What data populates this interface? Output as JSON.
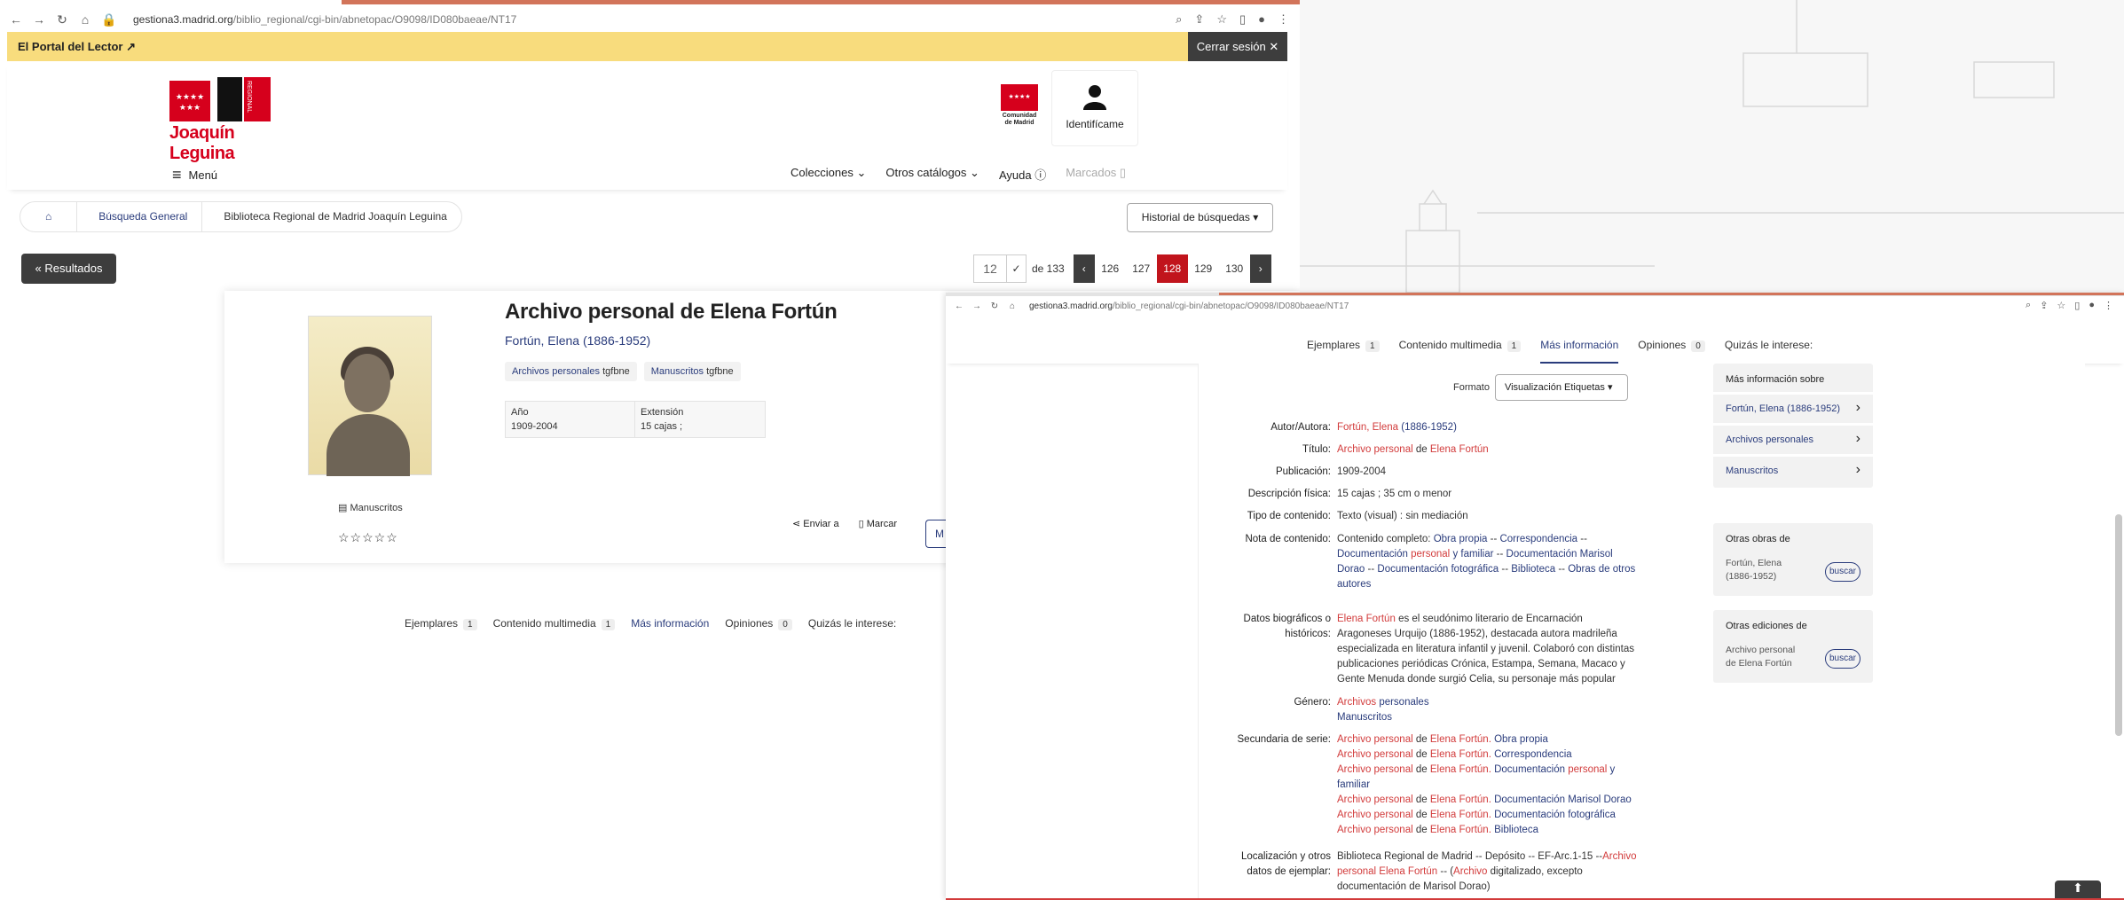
{
  "left_browser": {
    "url_host": "gestiona3.madrid.org",
    "url_path": "/biblio_regional/cgi-bin/abnetopac/O9098/ID080baeae/NT17"
  },
  "portal_bar": {
    "portal_label": "El Portal del Lector",
    "logout_label": "Cerrar sesión"
  },
  "header": {
    "logo_text": "Joaquín Leguina",
    "logo_flag": "★★★★ ★★★",
    "logo_regional": "REGIONAL",
    "cm_line1": "Comunidad",
    "cm_line2": "de Madrid",
    "identify_label": "Identifícame",
    "menu_label": "Menú",
    "nav": {
      "colecciones": "Colecciones",
      "otros": "Otros catálogos",
      "ayuda": "Ayuda",
      "marcados": "Marcados"
    }
  },
  "breadcrumb": {
    "general": "Búsqueda General",
    "library": "Biblioteca Regional de Madrid Joaquín Leguina"
  },
  "historial_label": "Historial de búsquedas",
  "resultados_label": "Resultados",
  "pager": {
    "input_value": "12",
    "total": "de 133",
    "pages": [
      "126",
      "127",
      "128",
      "129",
      "130"
    ],
    "current": "128"
  },
  "record": {
    "title": "Archivo personal de Elena Fortún",
    "author": "Fortún, Elena (1886-1952)",
    "tags": [
      {
        "link": "Archivos personales",
        "suffix": "tgfbne"
      },
      {
        "link": "Manuscritos",
        "suffix": "tgfbne"
      }
    ],
    "year_label": "Año",
    "year_value": "1909-2004",
    "extent_label": "Extensión",
    "extent_value": "15 cajas ;",
    "material": "Manuscritos",
    "stars": "☆☆☆☆☆",
    "send_label": "Enviar a",
    "mark_label": "Marcar",
    "more_btn": "M"
  },
  "tabs": [
    {
      "label": "Ejemplares",
      "badge": "1"
    },
    {
      "label": "Contenido multimedia",
      "badge": "1"
    },
    {
      "label": "Más información",
      "badge": ""
    },
    {
      "label": "Opiniones",
      "badge": "0"
    },
    {
      "label": "Quizás le interese:",
      "badge": ""
    }
  ],
  "details": {
    "formato_label": "Formato",
    "formato_value": "Visualización Etiquetas",
    "fields": {
      "autor": {
        "label": "Autor/Autora:",
        "red": "Fortún, Elena",
        "blue": "(1886-1952)"
      },
      "titulo": {
        "label": "Título:",
        "red1": "Archivo personal",
        "mid": "de",
        "red2": "Elena Fortún"
      },
      "publicacion": {
        "label": "Publicación:",
        "value": "1909-2004"
      },
      "descripcion": {
        "label": "Descripción física:",
        "value": "15 cajas ; 35 cm o menor"
      },
      "tipo": {
        "label": "Tipo de contenido:",
        "value": "Texto (visual) : sin mediación"
      },
      "nota": {
        "label": "Nota de contenido:",
        "prefix": "Contenido completo:",
        "p1": "Obra propia",
        "p2": "Correspondencia",
        "p3a": "Documentación",
        "p3b": "personal",
        "p3c": "y familiar",
        "p4": "Documentación Marisol Dorao",
        "p5": "Documentación fotográfica",
        "p6": "Biblioteca",
        "p7": "Obras de otros autores"
      },
      "bio": {
        "label1": "Datos biográficos o",
        "label2": "históricos:",
        "red": "Elena Fortún",
        "text": "es el seudónimo literario de Encarnación Aragoneses Urquijo (1886-1952), destacada autora madrileña especializada en literatura infantil y juvenil. Colaboró con distintas publicaciones periódicas Crónica, Estampa, Semana, Macaco y Gente Menuda donde surgió Celia, su personaje más popular"
      },
      "genero": {
        "label": "Género:",
        "g1a": "Archivos",
        "g1b": "personales",
        "g2": "Manuscritos"
      },
      "serie": {
        "label": "Secundaria de serie:",
        "red1": "Archivo personal",
        "de": "de",
        "red2": "Elena Fortún.",
        "items": [
          "Obra propia",
          "Correspondencia",
          "Documentación",
          "personal",
          "y familiar",
          "Documentación Marisol Dorao",
          "Documentación fotográfica",
          "Biblioteca"
        ]
      },
      "localizacion": {
        "label1": "Localización y otros",
        "label2": "datos de ejemplar:",
        "text1": "Biblioteca Regional de Madrid -- Depósito -- EF-Arc.1-15 --",
        "red1": "Archivo",
        "red2": "personal Elena Fortún",
        "text2": "-- (",
        "red3": "Archivo",
        "text3": "digitalizado, excepto documentación de Marisol Dorao)"
      }
    },
    "sidebar": {
      "more_title": "Más información sobre",
      "more_items": [
        "Fortún, Elena (1886-1952)",
        "Archivos personales",
        "Manuscritos"
      ],
      "other_works_title": "Otras obras de",
      "other_works_item": "Fortún, Elena (1886-1952)",
      "other_editions_title": "Otras ediciones de",
      "other_editions_item": "Archivo personal de Elena Fortún",
      "buscar": "buscar"
    }
  }
}
